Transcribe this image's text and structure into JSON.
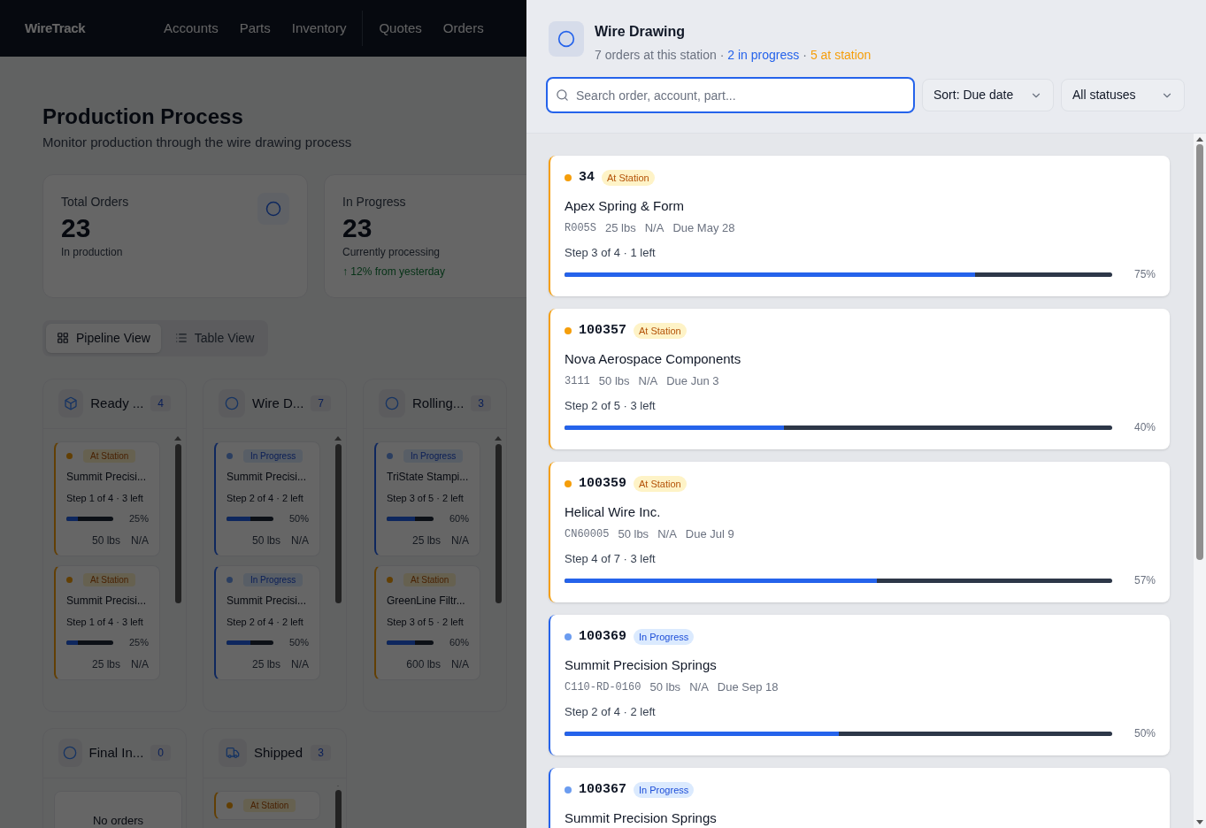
{
  "nav": {
    "logo": "WireTrack",
    "items": [
      "Accounts",
      "Parts",
      "Inventory",
      "Quotes",
      "Orders"
    ]
  },
  "page": {
    "title": "Production Process",
    "subtitle": "Monitor production through the wire drawing process"
  },
  "stats": [
    {
      "label": "Total Orders",
      "value": "23",
      "note": "In production",
      "kind": "circle"
    },
    {
      "label": "In Progress",
      "value": "23",
      "note": "Currently processing",
      "trend": "↑ 12% from yesterday"
    }
  ],
  "view_tabs": [
    {
      "label": "Pipeline View",
      "kind": "grid",
      "selected": true
    },
    {
      "label": "Table View",
      "kind": "list",
      "selected": false
    }
  ],
  "columns": [
    {
      "title": "Ready ...",
      "count": "4",
      "kind": "cube",
      "cards": [
        {
          "kind": "at_station",
          "badge": "At Station",
          "name": "Summit Precisi...",
          "step": "Step 1 of 4 · 3 left",
          "level": 0.25,
          "pct": "25%",
          "weight": "50 lbs",
          "spec": "N/A"
        },
        {
          "kind": "at_station",
          "badge": "At Station",
          "name": "Summit Precisi...",
          "step": "Step 1 of 4 · 3 left",
          "level": 0.25,
          "pct": "25%",
          "weight": "25 lbs",
          "spec": "N/A"
        }
      ]
    },
    {
      "title": "Wire D...",
      "count": "7",
      "kind": "circle",
      "cards": [
        {
          "kind": "in_progress",
          "badge": "In Progress",
          "name": "Summit Precisi...",
          "step": "Step 2 of 4 · 2 left",
          "level": 0.5,
          "pct": "50%",
          "weight": "50 lbs",
          "spec": "N/A"
        },
        {
          "kind": "in_progress",
          "badge": "In Progress",
          "name": "Summit Precisi...",
          "step": "Step 2 of 4 · 2 left",
          "level": 0.5,
          "pct": "50%",
          "weight": "25 lbs",
          "spec": "N/A"
        }
      ]
    },
    {
      "title": "Rolling...",
      "count": "3",
      "kind": "circle",
      "cards": [
        {
          "kind": "in_progress",
          "badge": "In Progress",
          "name": "TriState Stampi...",
          "step": "Step 3 of 5 · 2 left",
          "level": 0.6,
          "pct": "60%",
          "weight": "25 lbs",
          "spec": "N/A"
        },
        {
          "kind": "at_station",
          "badge": "At Station",
          "name": "GreenLine Filtr...",
          "step": "Step 3 of 5 · 2 left",
          "level": 0.6,
          "pct": "60%",
          "weight": "600 lbs",
          "spec": "N/A"
        }
      ]
    },
    {
      "title": "Final In...",
      "count": "0",
      "kind": "circle",
      "empty_text": "No orders"
    },
    {
      "title": "Shipped",
      "count": "3",
      "kind": "truck",
      "cards": [
        {
          "kind": "at_station",
          "badge": "At Station"
        }
      ]
    }
  ],
  "drawer": {
    "title": "Wire Drawing",
    "summary": [
      {
        "text": "7 orders at this station ·",
        "kind": "plain"
      },
      {
        "text": "2 in progress",
        "kind": "in_progress"
      },
      {
        "text": "·",
        "kind": "plain"
      },
      {
        "text": "5 at station",
        "kind": "at_station"
      }
    ],
    "search": {
      "placeholder": "Search order, account, part..."
    },
    "sort": "Sort: Due date",
    "filter": "All statuses",
    "orders": [
      {
        "number": "34",
        "kind": "at_station",
        "badge": "At Station",
        "account": "Apex Spring & Form",
        "part": "R005S",
        "weight": "25 lbs",
        "spec": "N/A",
        "due": "Due May 28",
        "step": "Step 3 of 4 · 1 left",
        "level": 0.75,
        "pct": "75%"
      },
      {
        "number": "100357",
        "kind": "at_station",
        "badge": "At Station",
        "account": "Nova Aerospace Components",
        "part": "3111",
        "weight": "50 lbs",
        "spec": "N/A",
        "due": "Due Jun 3",
        "step": "Step 2 of 5 · 3 left",
        "level": 0.4,
        "pct": "40%"
      },
      {
        "number": "100359",
        "kind": "at_station",
        "badge": "At Station",
        "account": "Helical Wire Inc.",
        "part": "CN60005",
        "weight": "50 lbs",
        "spec": "N/A",
        "due": "Due Jul 9",
        "step": "Step 4 of 7 · 3 left",
        "level": 0.57,
        "pct": "57%"
      },
      {
        "number": "100369",
        "kind": "in_progress",
        "badge": "In Progress",
        "account": "Summit Precision Springs",
        "part": "C110-RD-0160",
        "weight": "50 lbs",
        "spec": "N/A",
        "due": "Due Sep 18",
        "step": "Step 2 of 4 · 2 left",
        "level": 0.5,
        "pct": "50%"
      },
      {
        "number": "100367",
        "kind": "in_progress",
        "badge": "In Progress",
        "account": "Summit Precision Springs"
      }
    ]
  }
}
